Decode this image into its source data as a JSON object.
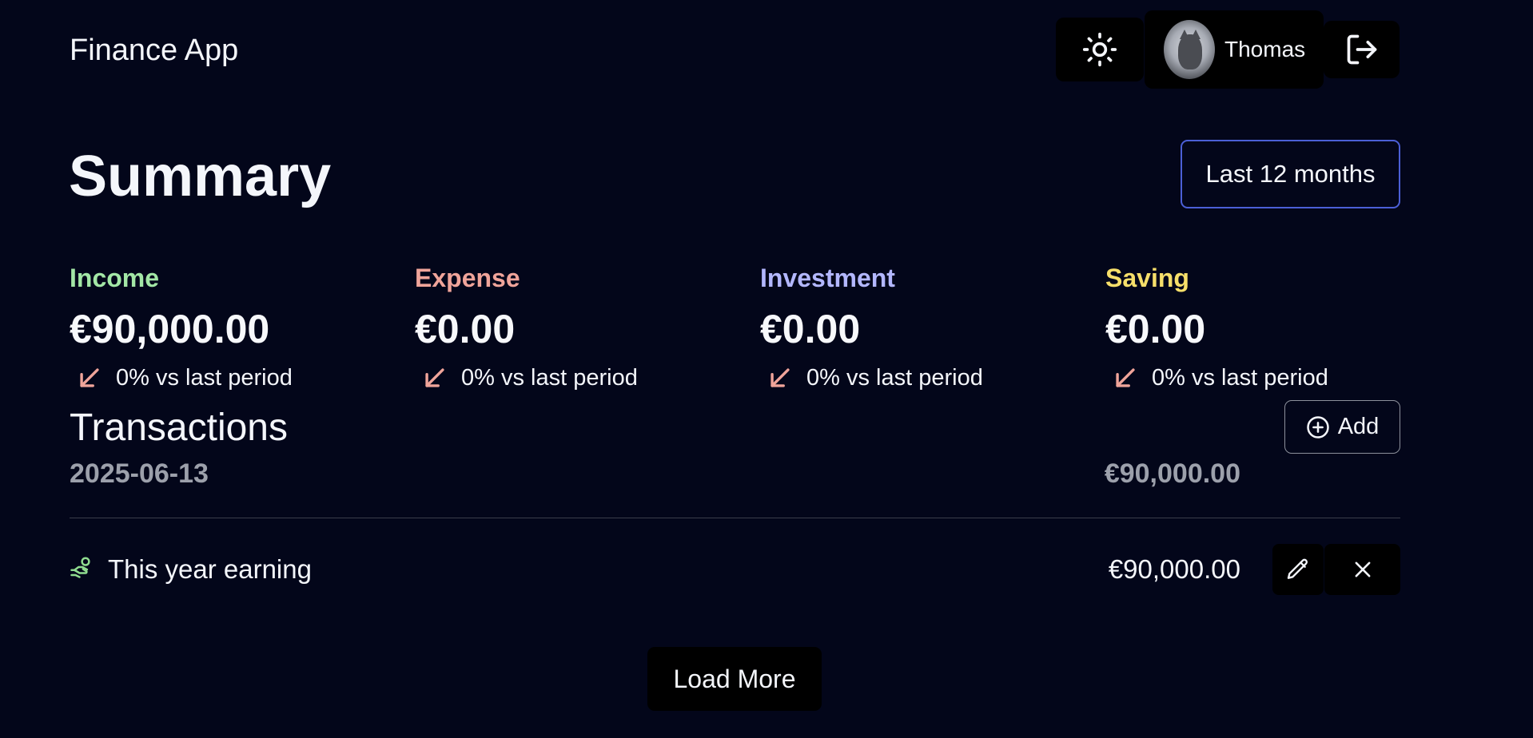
{
  "header": {
    "app_title": "Finance App",
    "user_name": "Thomas",
    "theme_icon": "sun-icon",
    "logout_icon": "logout-icon"
  },
  "summary": {
    "title": "Summary",
    "period_label": "Last 12 months",
    "stats": [
      {
        "label": "Income",
        "value": "€90,000.00",
        "change": "0% vs last period",
        "color": "#a3e7a6"
      },
      {
        "label": "Expense",
        "value": "€0.00",
        "change": "0% vs last period",
        "color": "#f0a49a"
      },
      {
        "label": "Investment",
        "value": "€0.00",
        "change": "0% vs last period",
        "color": "#b3b7ff"
      },
      {
        "label": "Saving",
        "value": "€0.00",
        "change": "0% vs last period",
        "color": "#f7df6a"
      }
    ],
    "trend_icon_color": "#f0a49a"
  },
  "transactions": {
    "title": "Transactions",
    "add_label": "Add",
    "groups": [
      {
        "date": "2025-06-13",
        "total": "€90,000.00",
        "items": [
          {
            "name": "This year earning",
            "amount": "€90,000.00",
            "icon": "income-hand-coin-icon",
            "icon_color": "#8fdc8f"
          }
        ]
      }
    ],
    "load_more_label": "Load More"
  },
  "colors": {
    "background": "#03061a",
    "accent_border": "#4b5fd6"
  }
}
